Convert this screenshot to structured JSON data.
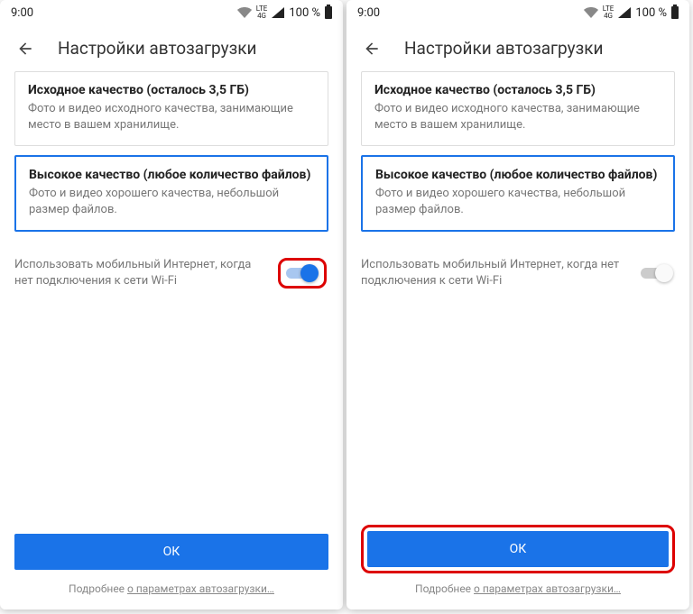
{
  "status": {
    "time": "9:00",
    "lte_top": "LTE",
    "lte_bottom": "4G",
    "battery_pct": "100 %"
  },
  "header": {
    "title": "Настройки автозагрузки"
  },
  "cards": {
    "original": {
      "title": "Исходное качество (осталось 3,5 ГБ)",
      "desc": "Фото и видео исходного качества, занимающие место в вашем хранилище."
    },
    "high": {
      "title": "Высокое качество (любое количество файлов)",
      "desc": "Фото и видео хорошего качества, небольшой размер файлов."
    }
  },
  "toggle": {
    "label": "Использовать мобильный Интернет, когда нет подключения к сети Wi-Fi"
  },
  "ok_label": "ОК",
  "footer": {
    "prefix": "Подробнее ",
    "link": "о параметрах автозагрузки…"
  }
}
